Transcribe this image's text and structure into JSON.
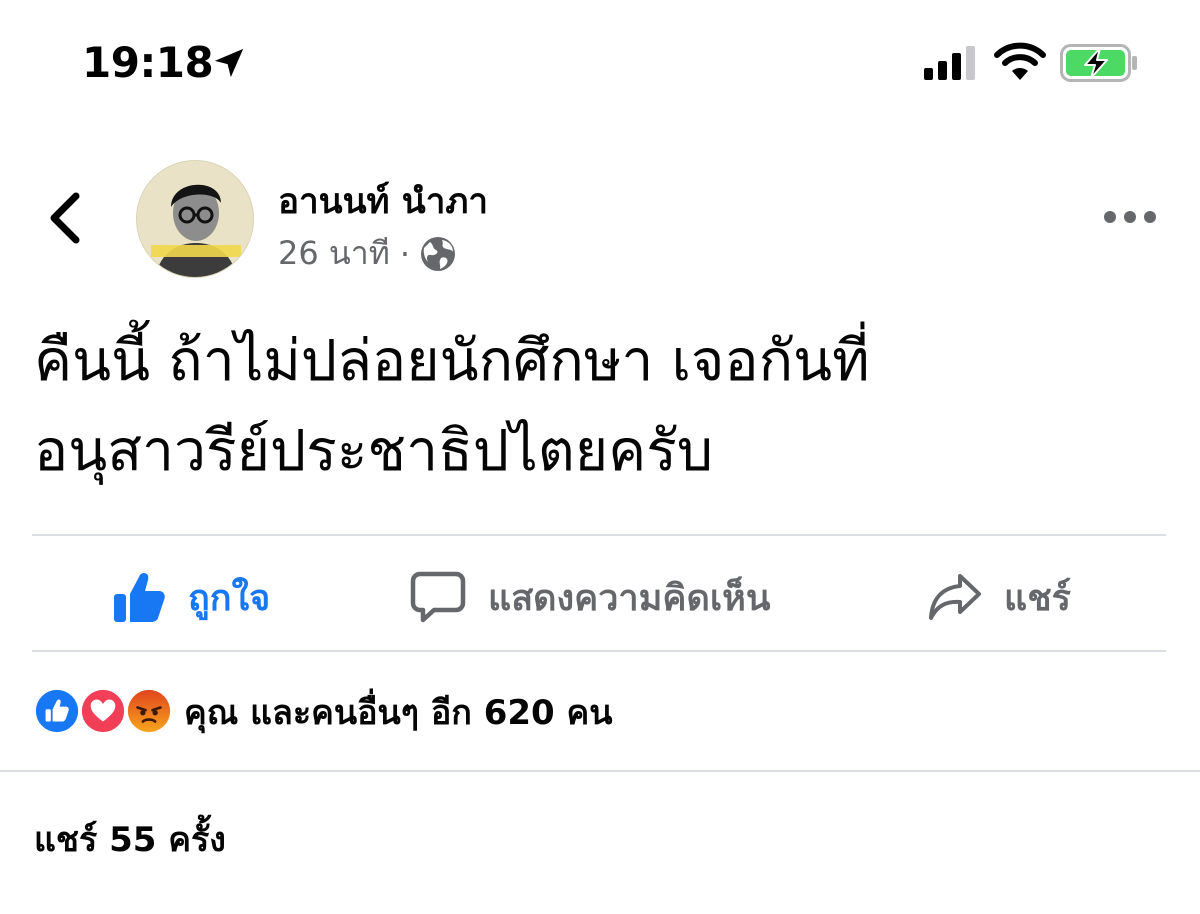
{
  "status_bar": {
    "time": "19:18",
    "icons": [
      "location-arrow-icon",
      "signal-icon",
      "wifi-icon",
      "battery-charging-icon"
    ]
  },
  "post": {
    "author": "อานนท์ นำภา",
    "time_ago": "26 นาที",
    "separator": "·",
    "privacy_icon": "globe-icon",
    "text_lines": [
      "คืนนี้ ถ้าไม่ปล่อยนักศึกษา เจอกันที่",
      "อนุสาวรีย์ประชาธิปไตยครับ"
    ]
  },
  "actions": {
    "like_label": "ถูกใจ",
    "comment_label": "แสดงความคิดเห็น",
    "share_label": "แชร์"
  },
  "reactions": {
    "icons": [
      "like-reaction-icon",
      "love-reaction-icon",
      "angry-reaction-icon"
    ],
    "summary": "คุณ และคนอื่นๆ อีก 620 คน"
  },
  "share_count_text": "แชร์ 55 ครั้ง",
  "colors": {
    "accent": "#1877f2",
    "secondary_text": "#65676b",
    "love": "#f33e58",
    "angry": "#e9710f",
    "battery_green": "#4cd964"
  }
}
